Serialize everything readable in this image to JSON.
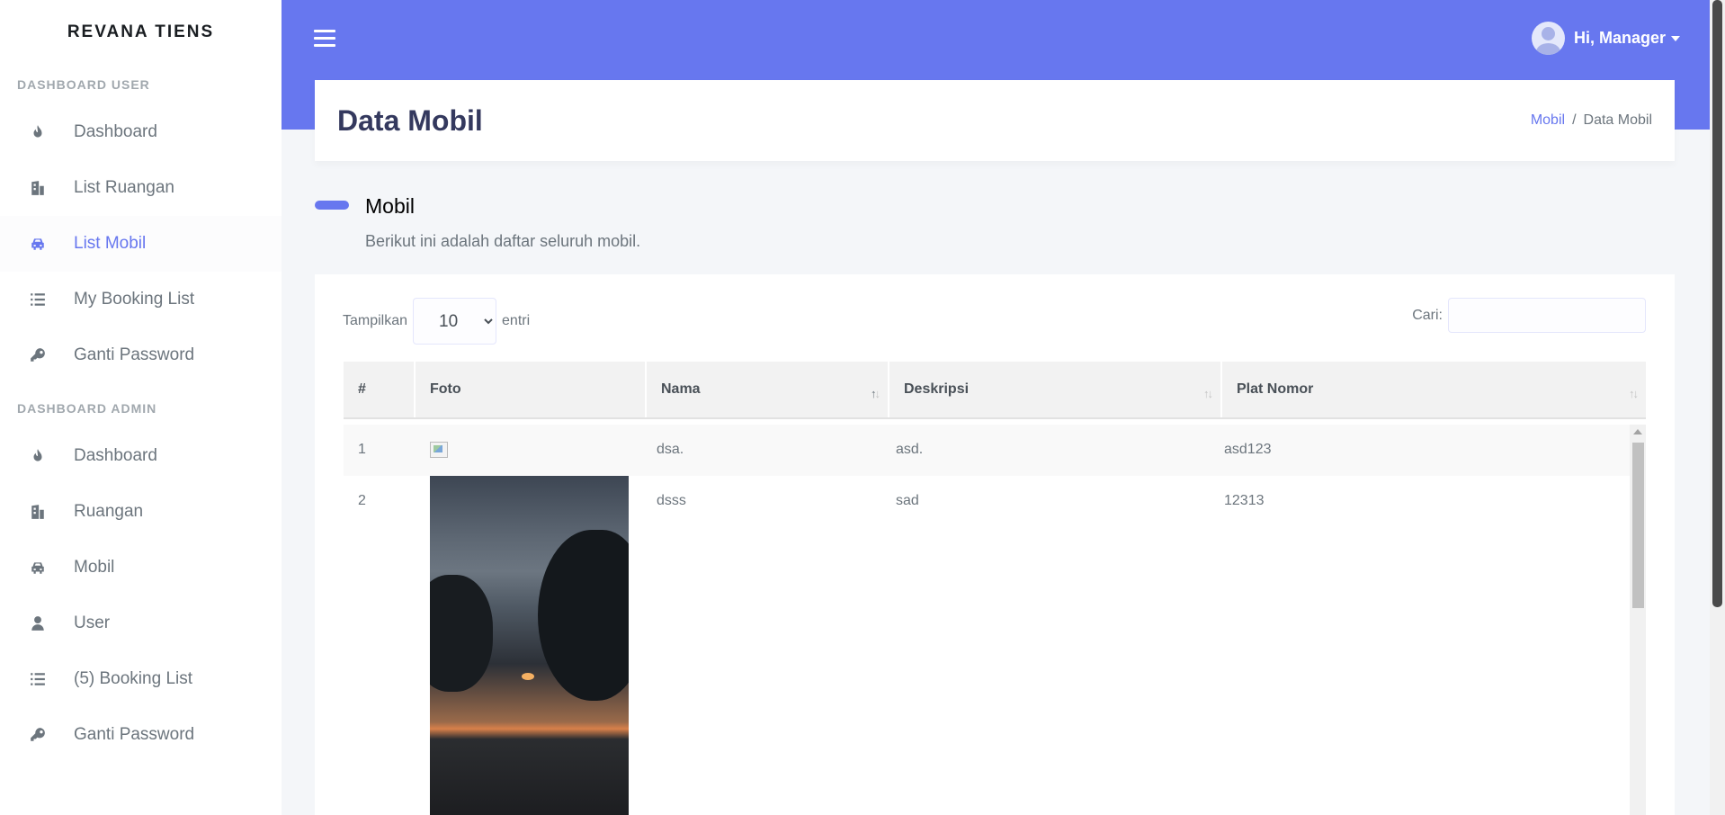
{
  "sidebar": {
    "brand": "REVANA TIENS",
    "user_header": "DASHBOARD USER",
    "user_items": [
      {
        "label": "Dashboard",
        "icon": "fire-icon"
      },
      {
        "label": "List Ruangan",
        "icon": "building-icon"
      },
      {
        "label": "List Mobil",
        "icon": "car-icon",
        "active": true
      },
      {
        "label": "My Booking List",
        "icon": "list-icon"
      },
      {
        "label": "Ganti Password",
        "icon": "key-icon"
      }
    ],
    "admin_header": "DASHBOARD ADMIN",
    "admin_items": [
      {
        "label": "Dashboard",
        "icon": "fire-icon"
      },
      {
        "label": "Ruangan",
        "icon": "building-icon"
      },
      {
        "label": "Mobil",
        "icon": "car-icon"
      },
      {
        "label": "User",
        "icon": "user-icon"
      },
      {
        "label": "(5) Booking List",
        "icon": "list-icon"
      },
      {
        "label": "Ganti Password",
        "icon": "key-icon"
      }
    ]
  },
  "header": {
    "greeting": "Hi, Manager",
    "accent_color": "#6777ef"
  },
  "page": {
    "title": "Data Mobil",
    "breadcrumb": {
      "link": "Mobil",
      "sep": "/",
      "current": "Data Mobil"
    },
    "section_title": "Mobil",
    "section_lead": "Berikut ini adalah daftar seluruh mobil."
  },
  "table": {
    "length_label_before": "Tampilkan",
    "length_value": "10",
    "length_label_after": "entri",
    "search_label": "Cari:",
    "search_value": "",
    "columns": [
      "#",
      "Foto",
      "Nama",
      "Deskripsi",
      "Plat Nomor"
    ],
    "rows": [
      {
        "no": "1",
        "nama": "dsa.",
        "deskripsi": "asd.",
        "plat": "asd123"
      },
      {
        "no": "2",
        "nama": "dsss",
        "deskripsi": "sad",
        "plat": "12313"
      }
    ]
  }
}
